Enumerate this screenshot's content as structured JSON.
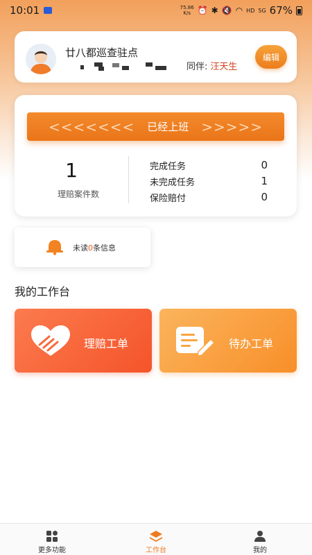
{
  "status_bar": {
    "time": "10:01",
    "net_speed_value": "75.86",
    "net_speed_unit": "K/s",
    "hd_label": "HD",
    "signal_label": "5G",
    "battery": "67%"
  },
  "profile": {
    "station_name": "廿八都巡查驻点",
    "partner_label": "同伴:",
    "partner_name": "汪天生",
    "edit_label": "编辑"
  },
  "work": {
    "clock_status": "已经上班",
    "arrows_left": "<<<<<<<",
    "arrows_right": ">>>>>",
    "case_count": "1",
    "case_label": "理赔案件数",
    "stats": [
      {
        "label": "完成任务",
        "value": "0"
      },
      {
        "label": "未完成任务",
        "value": "1"
      },
      {
        "label": "保险赔付",
        "value": "0"
      }
    ]
  },
  "notice": {
    "prefix": "未读",
    "count": "0",
    "suffix": "条信息"
  },
  "workbench": {
    "title": "我的工作台",
    "tiles": [
      {
        "label": "理赔工单",
        "icon": "heart-hands-icon"
      },
      {
        "label": "待办工单",
        "icon": "edit-document-icon"
      }
    ]
  },
  "nav": {
    "items": [
      {
        "label": "更多功能",
        "icon": "grid-icon"
      },
      {
        "label": "工作台",
        "icon": "layers-icon"
      },
      {
        "label": "我的",
        "icon": "user-icon"
      }
    ],
    "active_color": "#ee7b1f"
  },
  "colors": {
    "accent": "#ea7519",
    "accent_red": "#f5542a"
  }
}
